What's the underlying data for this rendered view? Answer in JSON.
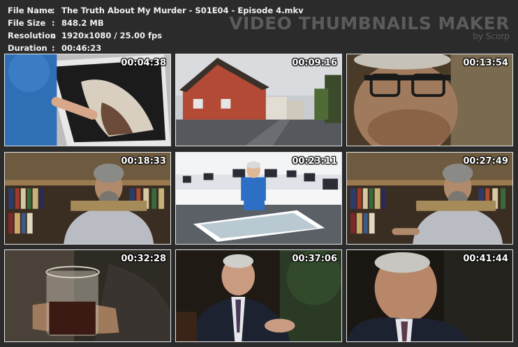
{
  "info": {
    "rows": [
      {
        "key": "File Name",
        "sep": ":",
        "value": "The Truth About My Murder - S01E04 - Episode 4.mkv"
      },
      {
        "key": "File Size",
        "sep": ":",
        "value": "848.2 MB"
      },
      {
        "key": "Resolution",
        "sep": ":",
        "value": "1920x1080 / 25.00 fps"
      },
      {
        "key": "Duration",
        "sep": ":",
        "value": "00:46:23"
      }
    ]
  },
  "brand": {
    "title": "VIDEO THUMBNAILS MAKER",
    "byline": "by Scorp"
  },
  "thumbnails": [
    {
      "timestamp": "00:04:38"
    },
    {
      "timestamp": "00:09:16"
    },
    {
      "timestamp": "00:13:54"
    },
    {
      "timestamp": "00:18:33"
    },
    {
      "timestamp": "00:23:11"
    },
    {
      "timestamp": "00:27:49"
    },
    {
      "timestamp": "00:32:28"
    },
    {
      "timestamp": "00:37:06"
    },
    {
      "timestamp": "00:41:44"
    }
  ]
}
